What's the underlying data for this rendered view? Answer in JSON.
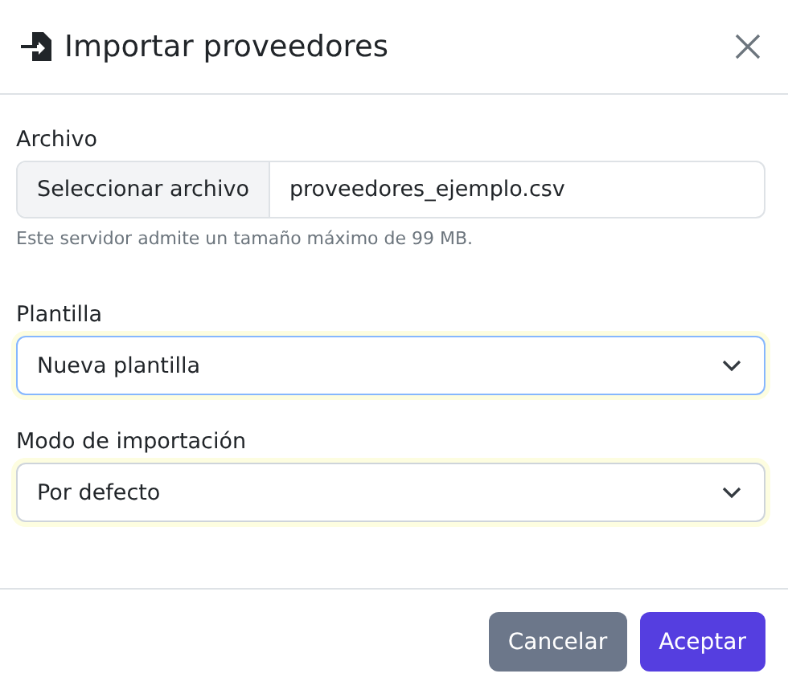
{
  "dialog": {
    "title": "Importar proveedores"
  },
  "file": {
    "label": "Archivo",
    "button": "Seleccionar archivo",
    "value": "proveedores_ejemplo.csv",
    "help": "Este servidor admite un tamaño máximo de 99 MB."
  },
  "selects": [
    {
      "label": "Plantilla",
      "value": "Nueva plantilla",
      "focused": true
    },
    {
      "label": "Modo de importación",
      "value": "Por defecto",
      "focused": false
    }
  ],
  "buttons": [
    {
      "label": "Cancelar",
      "kind": "secondary"
    },
    {
      "label": "Aceptar",
      "kind": "primary"
    }
  ]
}
